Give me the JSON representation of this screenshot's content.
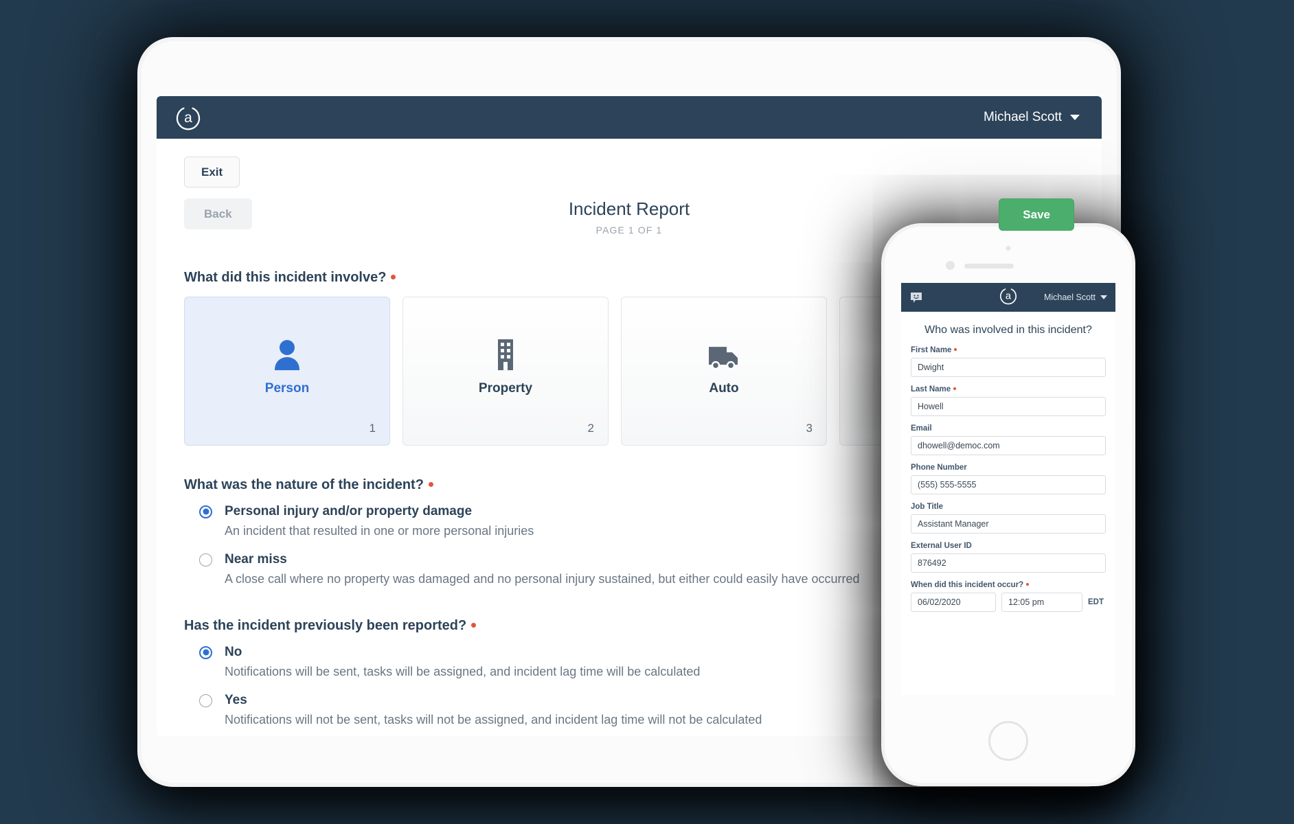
{
  "theme": {
    "background": "#223a4d",
    "appbar": "#2c4359",
    "accent_blue": "#2f6fd0",
    "save_green": "#4cae6d",
    "required_red": "#e2543f",
    "selected_card_bg": "#e8eefa"
  },
  "tablet": {
    "appbar": {
      "logo": "a-logo-icon",
      "user_name": "Michael Scott",
      "caret": "chevron-down-icon"
    },
    "toolbar": {
      "exit_label": "Exit",
      "back_label": "Back",
      "save_label": "Save"
    },
    "header": {
      "title": "Incident Report",
      "page_counter": "PAGE 1 OF 1"
    },
    "questions": [
      {
        "id": "involve",
        "text": "What did this incident involve?",
        "required": true,
        "type": "cards",
        "options": [
          {
            "label": "Person",
            "number": "1",
            "icon": "person-icon",
            "selected": true
          },
          {
            "label": "Property",
            "number": "2",
            "icon": "building-icon",
            "selected": false
          },
          {
            "label": "Auto",
            "number": "3",
            "icon": "truck-icon",
            "selected": false
          },
          {
            "label": "",
            "number": "",
            "icon": "",
            "selected": false
          }
        ]
      },
      {
        "id": "nature",
        "text": "What was the nature of the incident?",
        "required": true,
        "type": "radio",
        "options": [
          {
            "label": "Personal injury and/or property damage",
            "description": "An incident that resulted in one or more personal injuries",
            "checked": true
          },
          {
            "label": "Near miss",
            "description": "A close call where no property was damaged and no personal injury sustained, but either could easily have occurred",
            "checked": false
          }
        ]
      },
      {
        "id": "previously_reported",
        "text": "Has the incident previously been reported?",
        "required": true,
        "type": "radio",
        "options": [
          {
            "label": "No",
            "description": "Notifications will be sent, tasks will be assigned, and incident lag time will be calculated",
            "checked": true
          },
          {
            "label": "Yes",
            "description": "Notifications will not be sent, tasks will not be assigned, and incident lag time will not be calculated",
            "checked": false
          }
        ]
      }
    ]
  },
  "phone": {
    "appbar": {
      "chat_icon": "chat-bubble-icon",
      "logo": "a-logo-icon",
      "user_name": "Michael Scott",
      "caret": "chevron-down-icon"
    },
    "title": "Who was involved in this incident?",
    "fields": [
      {
        "label": "First Name",
        "required": true,
        "value": "Dwight"
      },
      {
        "label": "Last Name",
        "required": true,
        "value": "Howell"
      },
      {
        "label": "Email",
        "required": false,
        "value": "dhowell@democ.com"
      },
      {
        "label": "Phone Number",
        "required": false,
        "value": "(555) 555-5555"
      },
      {
        "label": "Job Title",
        "required": false,
        "value": "Assistant Manager"
      },
      {
        "label": "External User ID",
        "required": false,
        "value": "876492"
      }
    ],
    "datetime": {
      "label": "When did this incident occur?",
      "required": true,
      "date": "06/02/2020",
      "time": "12:05 pm",
      "timezone": "EDT"
    }
  }
}
